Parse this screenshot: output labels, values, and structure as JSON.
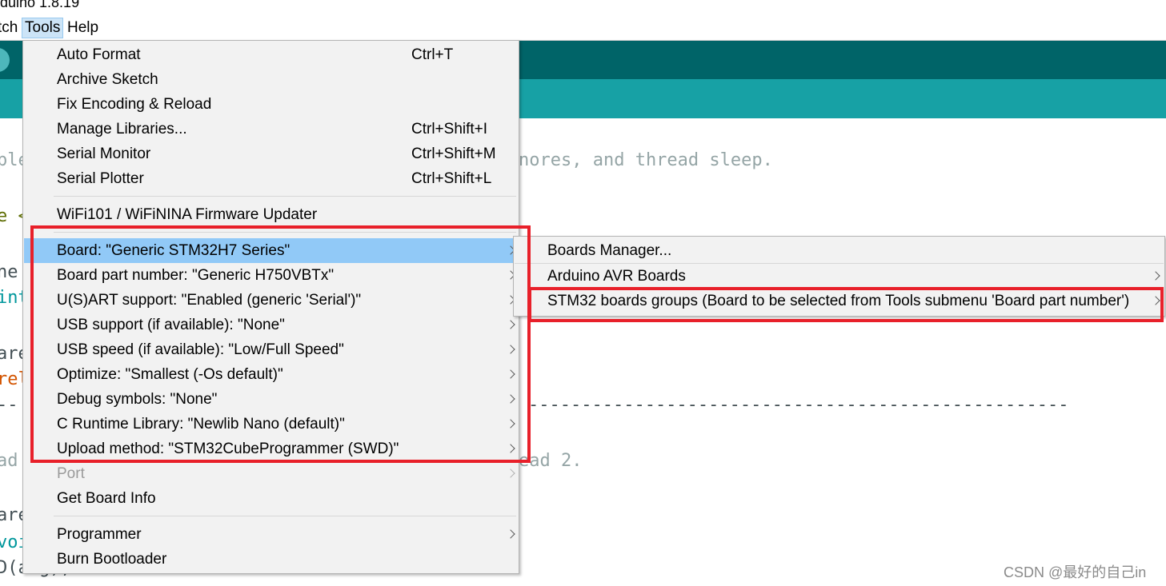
{
  "window": {
    "title": "rduino 1.8.19"
  },
  "menubar": {
    "items": [
      {
        "label": "tch"
      },
      {
        "label": "Tools"
      },
      {
        "label": "Help"
      }
    ]
  },
  "editor": {
    "lines": [
      "ple",
      "nores, and thread sleep.",
      "e <",
      "ne",
      "int",
      "are",
      "rel",
      "--",
      "---------------------------------------------------",
      "ad",
      "ead 2.",
      "are",
      "voi",
      "D(arg);"
    ]
  },
  "tools_menu": {
    "items": [
      {
        "label": "Auto Format",
        "shortcut": "Ctrl+T"
      },
      {
        "label": "Archive Sketch",
        "shortcut": ""
      },
      {
        "label": "Fix Encoding & Reload",
        "shortcut": ""
      },
      {
        "label": "Manage Libraries...",
        "shortcut": "Ctrl+Shift+I"
      },
      {
        "label": "Serial Monitor",
        "shortcut": "Ctrl+Shift+M"
      },
      {
        "label": "Serial Plotter",
        "shortcut": "Ctrl+Shift+L"
      },
      {
        "label": "WiFi101 / WiFiNINA Firmware Updater",
        "shortcut": ""
      },
      {
        "label": "Board: \"Generic STM32H7 Series\""
      },
      {
        "label": "Board part number: \"Generic H750VBTx\""
      },
      {
        "label": "U(S)ART support: \"Enabled (generic 'Serial')\""
      },
      {
        "label": "USB support (if available): \"None\""
      },
      {
        "label": "USB speed (if available): \"Low/Full Speed\""
      },
      {
        "label": "Optimize: \"Smallest (-Os default)\""
      },
      {
        "label": "Debug symbols: \"None\""
      },
      {
        "label": "C Runtime Library: \"Newlib Nano (default)\""
      },
      {
        "label": "Upload method: \"STM32CubeProgrammer (SWD)\""
      },
      {
        "label": "Port"
      },
      {
        "label": "Get Board Info"
      },
      {
        "label": "Programmer"
      },
      {
        "label": "Burn Bootloader"
      }
    ]
  },
  "board_submenu": {
    "items": [
      {
        "label": "Boards Manager..."
      },
      {
        "label": "Arduino AVR Boards"
      },
      {
        "label": "STM32 boards groups (Board to be selected from Tools submenu 'Board part number')"
      }
    ]
  },
  "watermark": "CSDN @最好的自己in",
  "colors": {
    "toolbar_dark": "#006468",
    "toolbar_light": "#17a1a5",
    "menu_bg": "#f2f2f2",
    "highlight": "#91c9f7",
    "annotation_red": "#e8202a"
  }
}
